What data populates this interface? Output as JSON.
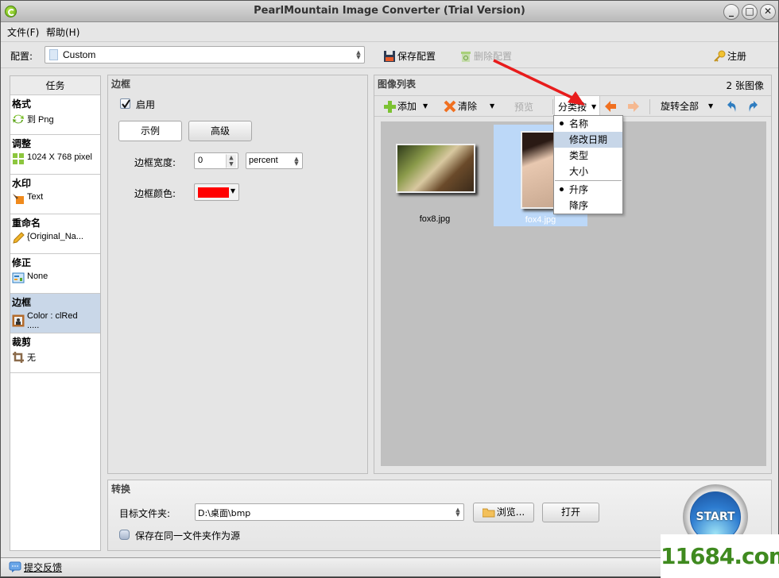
{
  "window": {
    "title": "PearlMountain Image Converter (Trial Version)",
    "buttons": {
      "minimize": "_",
      "maximize": "□",
      "close": "✕"
    }
  },
  "menu": {
    "items": [
      {
        "label": "文件(F)"
      },
      {
        "label": "帮助(H)"
      }
    ]
  },
  "toolbar": {
    "profile_label": "配置:",
    "profile_value": "Custom",
    "save_profile": "保存配置",
    "delete_profile": "删除配置",
    "register": "注册"
  },
  "tasks": {
    "header": "任务",
    "items": [
      {
        "title": "格式",
        "value": "到 Png",
        "icon": "convert-icon"
      },
      {
        "title": "调整",
        "value": "1024 X 768 pixel",
        "icon": "resize-icon"
      },
      {
        "title": "水印",
        "value": "Text",
        "icon": "watermark-icon"
      },
      {
        "title": "重命名",
        "value": "{Original_Na...",
        "icon": "pencil-icon"
      },
      {
        "title": "修正",
        "value": "None",
        "icon": "adjust-icon"
      },
      {
        "title": "边框",
        "value": "Color : clRed",
        "value2": ".....",
        "icon": "frame-icon",
        "active": true
      },
      {
        "title": "裁剪",
        "value": "无",
        "icon": "crop-icon"
      }
    ]
  },
  "border": {
    "title": "边框",
    "enable_label": "启用",
    "enabled": true,
    "tab_example": "示例",
    "tab_advanced": "高级",
    "width_label": "边框宽度:",
    "width_value": "0",
    "unit_value": "percent",
    "color_label": "边框颜色:",
    "color_value": "#ff0000"
  },
  "imagelist": {
    "title": "图像列表",
    "count": "2 张图像",
    "add": "添加",
    "clear": "清除",
    "preview": "预览",
    "sort_by": "分类按",
    "rotate_all": "旋转全部",
    "images": [
      {
        "name": "fox8.jpg",
        "selected": false
      },
      {
        "name": "fox4.jpg",
        "selected": true
      }
    ],
    "sort_menu": {
      "items": [
        {
          "label": "名称",
          "checked": true
        },
        {
          "label": "修改日期",
          "highlighted": true
        },
        {
          "label": "类型"
        },
        {
          "label": "大小"
        }
      ],
      "order": [
        {
          "label": "升序",
          "checked": true
        },
        {
          "label": "降序"
        }
      ]
    }
  },
  "convert": {
    "title": "转换",
    "target_label": "目标文件夹:",
    "target_value": "D:\\桌面\\bmp",
    "browse": "浏览...",
    "open": "打开",
    "same_folder_label": "保存在同一文件夹作为源",
    "same_folder_checked": false,
    "start": "START"
  },
  "status": {
    "feedback": "提交反馈"
  },
  "watermark": "11684.com"
}
